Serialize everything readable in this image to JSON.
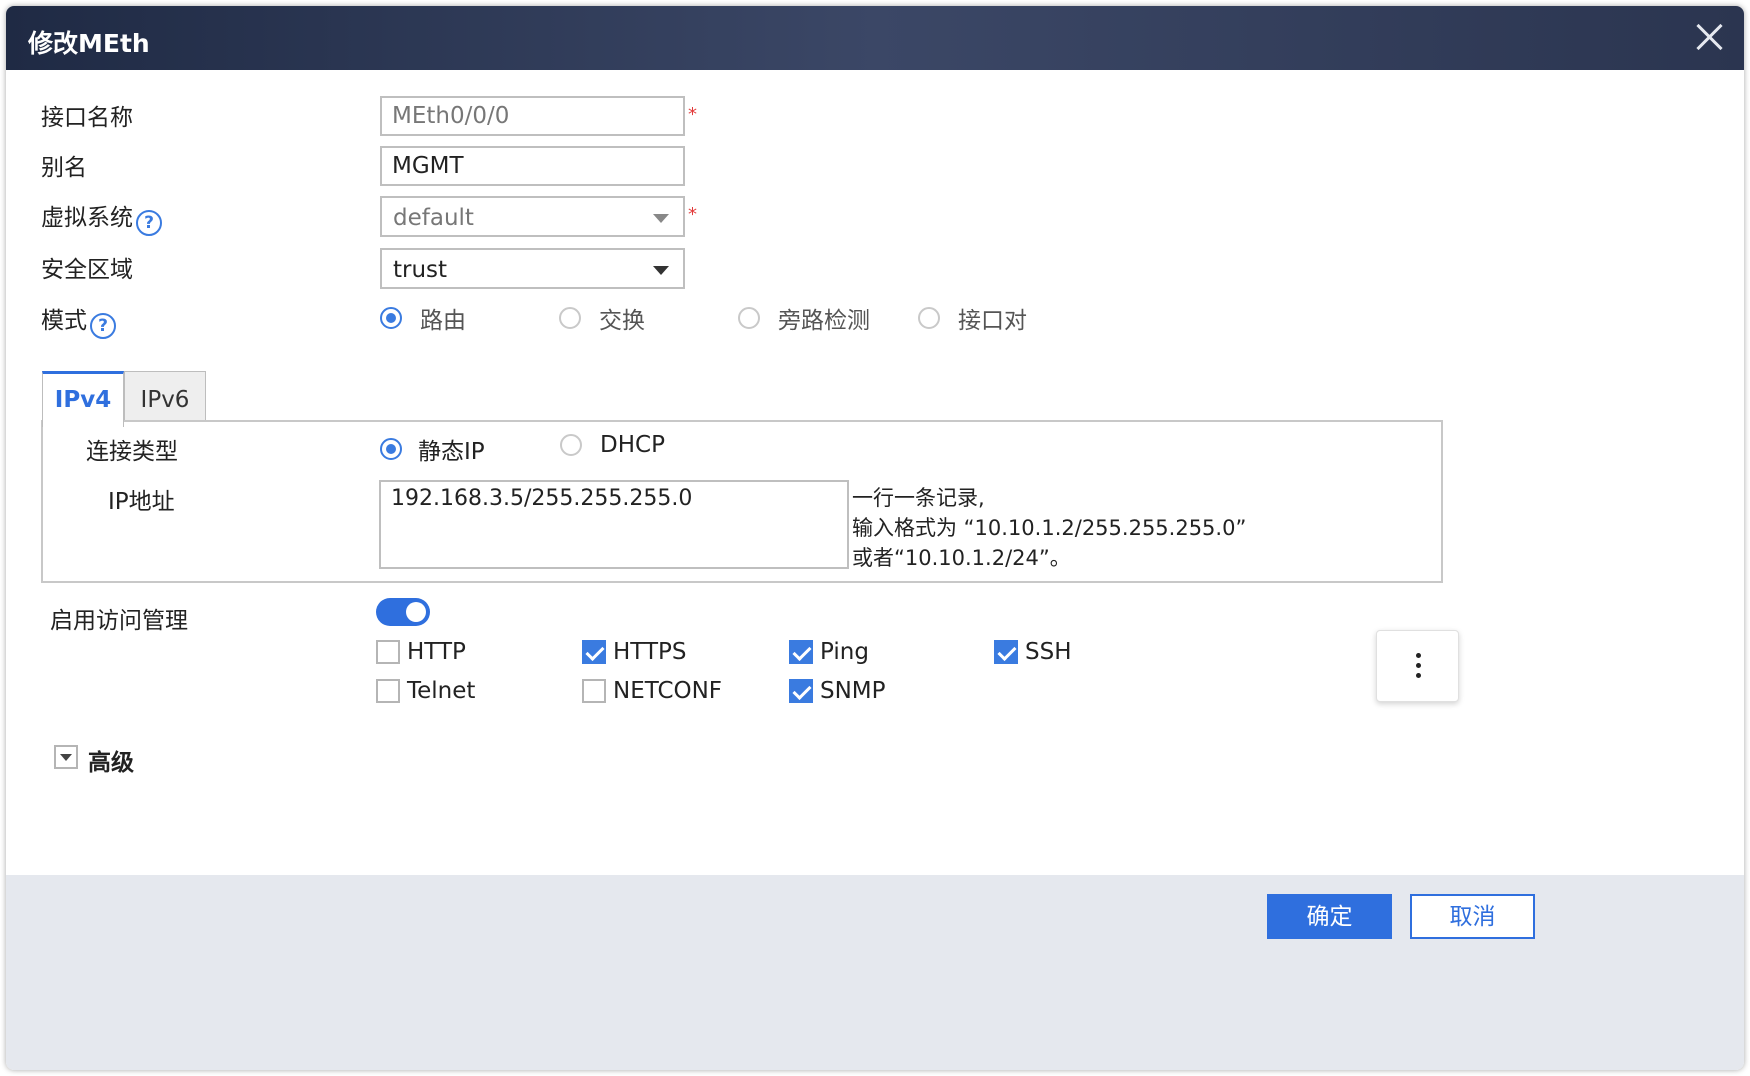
{
  "dialog": {
    "title": "修改MEth"
  },
  "fields": {
    "interface_name": {
      "label": "接口名称",
      "value": "MEth0/0/0",
      "required_mark": "*"
    },
    "alias": {
      "label": "别名",
      "value": "MGMT"
    },
    "virtual_system": {
      "label": "虚拟系统",
      "value": "default",
      "required_mark": "*",
      "help": "?"
    },
    "security_zone": {
      "label": "安全区域",
      "value": "trust"
    },
    "mode": {
      "label": "模式",
      "help": "?",
      "options": [
        "路由",
        "交换",
        "旁路检测",
        "接口对"
      ],
      "selected": "路由"
    }
  },
  "tabs": [
    {
      "label": "IPv4",
      "active": true
    },
    {
      "label": "IPv6",
      "active": false
    }
  ],
  "ipv4": {
    "connection_type": {
      "label": "连接类型",
      "options": [
        "静态IP",
        "DHCP"
      ],
      "selected": "静态IP"
    },
    "ip_address": {
      "label": "IP地址",
      "value": "192.168.3.5/255.255.255.0",
      "hint": [
        "一行一条记录,",
        "输入格式为 “10.10.1.2/255.255.255.0”",
        "或者“10.10.1.2/24”。"
      ]
    }
  },
  "access_management": {
    "label": "启用访问管理",
    "enabled": true,
    "services": [
      {
        "label": "HTTP",
        "checked": false
      },
      {
        "label": "HTTPS",
        "checked": true
      },
      {
        "label": "Ping",
        "checked": true
      },
      {
        "label": "SSH",
        "checked": true
      },
      {
        "label": "Telnet",
        "checked": false
      },
      {
        "label": "NETCONF",
        "checked": false
      },
      {
        "label": "SNMP",
        "checked": true
      }
    ]
  },
  "advanced": {
    "label": "高级",
    "expanded": false
  },
  "buttons": {
    "ok": "确定",
    "cancel": "取消"
  },
  "icons": {
    "close": "close-icon",
    "help": "help-icon",
    "more": "more-vertical-icon",
    "dropdown": "chevron-down-icon"
  },
  "colors": {
    "accent": "#2f6fde",
    "titlebar": "#2b3550",
    "required": "#e23b3b",
    "footer": "#e5e8ee"
  }
}
